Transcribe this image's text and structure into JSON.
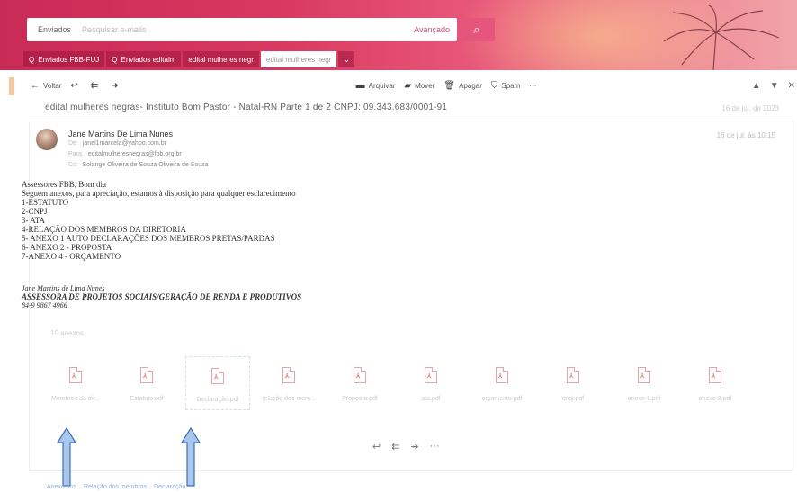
{
  "search": {
    "folder": "Enviados",
    "placeholder": "Pesquisar e-mails",
    "advanced_label": "Avançado",
    "search_icon": "search-icon"
  },
  "tabs": [
    {
      "label": "Enviados FBB-FUJ",
      "icon": "search-icon"
    },
    {
      "label": "Enviados editalm",
      "icon": "search-icon"
    },
    {
      "label": "edital mulheres negr",
      "icon": ""
    },
    {
      "label": "edital mulheres negr",
      "icon": "",
      "active": true
    }
  ],
  "toolbar": {
    "back_label": "Voltar",
    "reply_icon": "reply-icon",
    "reply_all_icon": "reply-all-icon",
    "forward_icon": "forward-icon",
    "archive_label": "Arquivar",
    "move_label": "Mover",
    "delete_label": "Apagar",
    "spam_label": "Spam",
    "more_label": "···",
    "nav_up": "▲",
    "nav_down": "▼",
    "close": "✕"
  },
  "subject": "edital mulheres negras- Instituto Bom Pastor - Natal-RN Parte 1 de 2 CNPJ: 09.343.683/0001-91",
  "subject_date": "16 de jul. de 2023",
  "message": {
    "sender_name": "Jane Martins De Lima Nunes",
    "from_email": "janel1marcela@yahoo.com.br",
    "to_email": "editalmulheresnegras@fbb.org.br",
    "cc_name": "Solange Oliveira de Souza Oliveira de Souza",
    "from_label": "De:",
    "to_label": "Para:",
    "cc_label": "Cc:",
    "tools": "16 de jul. às 10:15",
    "body_lines": [
      "Assessores FBB, Bom dia",
      "Seguem anexos, para apreciação, estamos à disposição para qualquer esclarecimento",
      "1-ESTATUTO",
      "2-CNPJ",
      "3- ATA",
      "4-RELAÇÃO DOS MEMBROS DA DIRETORIA",
      "5- ANEXO 1 AUTO DECLARAÇÕES DOS MEMBROS PRETAS/PARDAS",
      "6- ANEXO 2 - PROPOSTA",
      "7-ANEXO 4 - ORÇAMENTO"
    ],
    "signature": {
      "name": "Jane Martins de Lima Nunes",
      "role": "ASSESSORA DE PROJETOS SOCIAIS/GERAÇÃO DE RENDA E PRODUTIVOS",
      "phone": "84-9 9867 4966"
    },
    "attachments_header": "10 anexos",
    "attachments": [
      {
        "name": "Membros da dir...",
        "selected": false
      },
      {
        "name": "Estatuto.pdf",
        "selected": false
      },
      {
        "name": "Declaração.pdf",
        "selected": true
      },
      {
        "name": "relação dos mem...",
        "selected": false
      },
      {
        "name": "Proposta.pdf",
        "selected": false
      },
      {
        "name": "ata.pdf",
        "selected": false
      },
      {
        "name": "orçamento.pdf",
        "selected": false
      },
      {
        "name": "cnpj.pdf",
        "selected": false
      },
      {
        "name": "anexo 1.pdf",
        "selected": false
      },
      {
        "name": "anexo 2.pdf",
        "selected": false
      }
    ]
  },
  "reply_row": {
    "reply": "↩",
    "reply_all": "⇇",
    "forward": "➜",
    "more": "···"
  },
  "footer_links": [
    "Anexo dos",
    "Relação dos membros",
    "Declaração"
  ],
  "colors": {
    "accent": "#e6557c",
    "arrow": "#9ec1ea"
  }
}
